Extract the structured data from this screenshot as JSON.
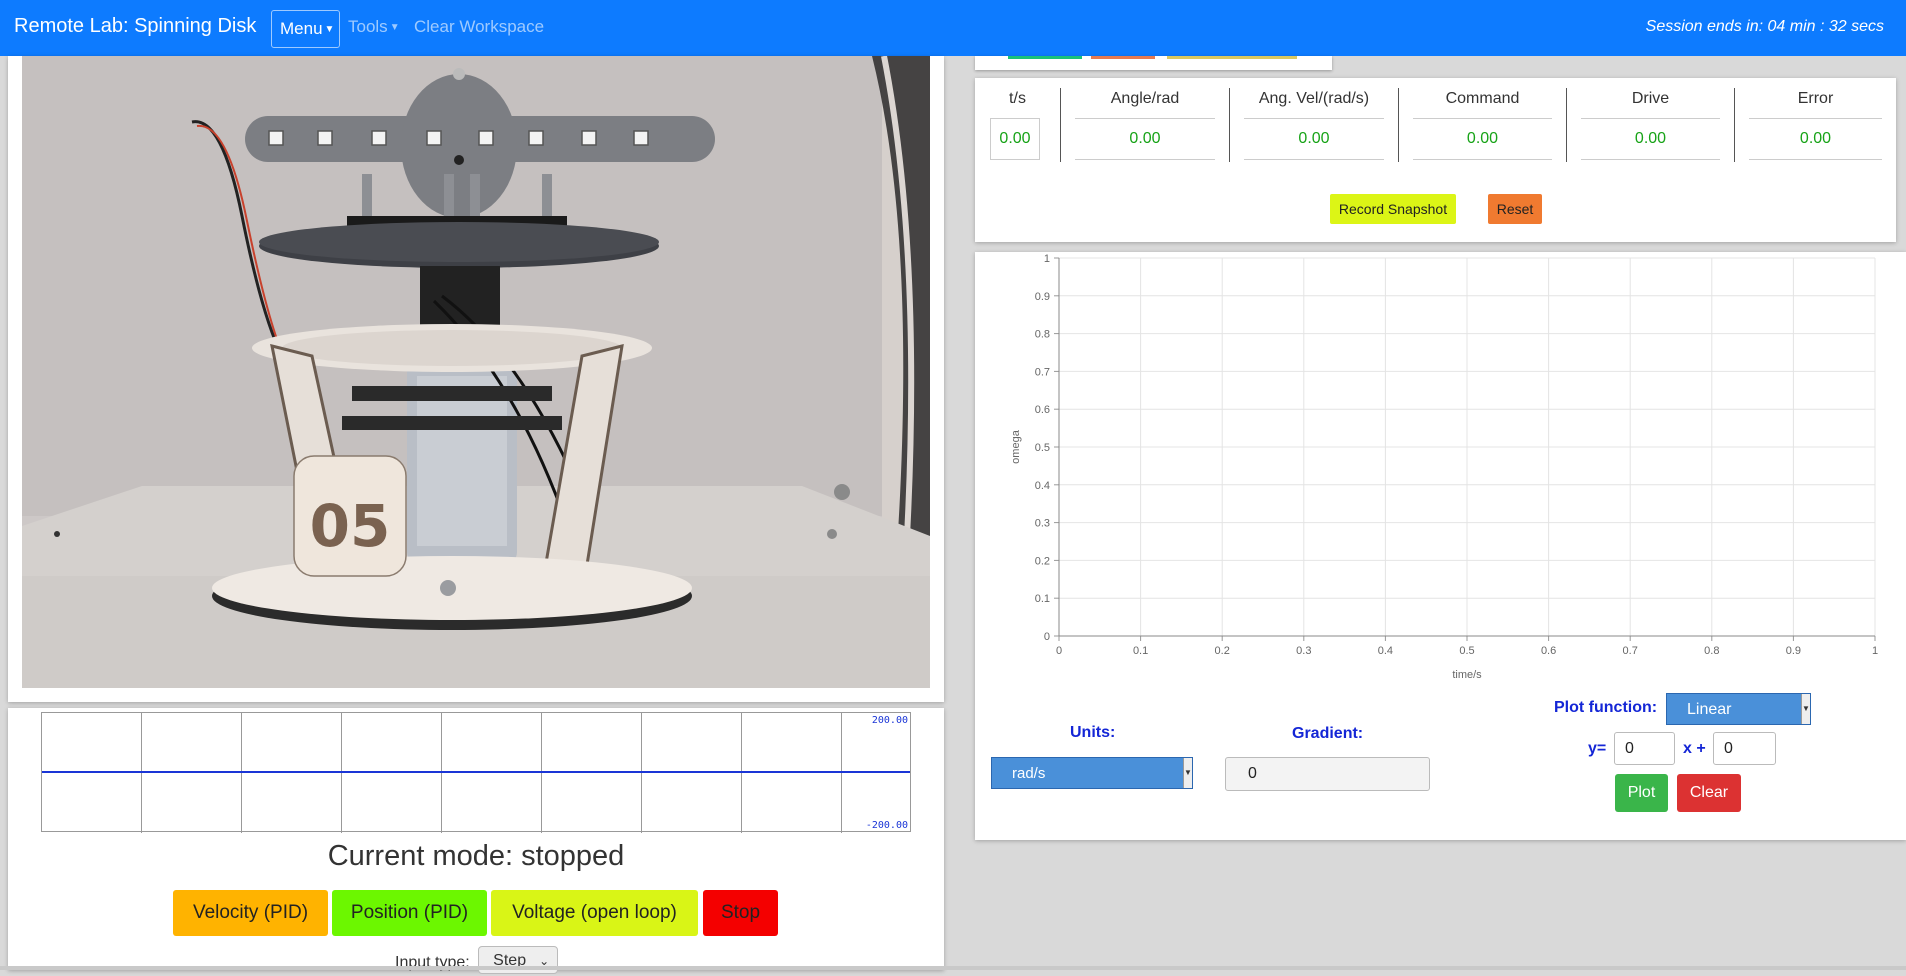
{
  "nav": {
    "brand": "Remote Lab: Spinning Disk",
    "menu": "Menu",
    "tools": "Tools",
    "clear_workspace": "Clear Workspace",
    "session": "Session ends in: 04 min : 32 secs"
  },
  "video": {
    "disk_number": "05"
  },
  "scope": {
    "top_label": "200.00",
    "bottom_label": "-200.00"
  },
  "mode": {
    "current": "Current mode: stopped",
    "buttons": [
      "Velocity (PID)",
      "Position (PID)",
      "Voltage (open loop)",
      "Stop"
    ],
    "colors": [
      "#ffb300",
      "#6cf700",
      "#d9f516",
      "#f40000"
    ],
    "input_type_label": "Input type:",
    "input_type_value": "Step"
  },
  "data_table": {
    "headers": [
      "t/s",
      "Angle/rad",
      "Ang. Vel/(rad/s)",
      "Command",
      "Drive",
      "Error"
    ],
    "values": [
      "0.00",
      "0.00",
      "0.00",
      "0.00",
      "0.00",
      "0.00"
    ],
    "record_snapshot": "Record Snapshot",
    "reset": "Reset"
  },
  "chart_data": {
    "type": "line",
    "xlabel": "time/s",
    "ylabel": "omega",
    "xlim": [
      0,
      1
    ],
    "ylim": [
      0,
      1
    ],
    "xticks": [
      "0",
      "0.1",
      "0.2",
      "0.3",
      "0.4",
      "0.5",
      "0.6",
      "0.7",
      "0.8",
      "0.9",
      "1"
    ],
    "yticks": [
      "0",
      "0.1",
      "0.2",
      "0.3",
      "0.4",
      "0.5",
      "0.6",
      "0.7",
      "0.8",
      "0.9",
      "1"
    ],
    "grid": true,
    "series": []
  },
  "plot_controls": {
    "units_label": "Units:",
    "units_value": "rad/s",
    "gradient_label": "Gradient:",
    "gradient_value": "0",
    "plot_function_label": "Plot function:",
    "plot_function_value": "Linear",
    "y_label": "y=",
    "y_value": "0",
    "x_label": "x +",
    "x_value": "0",
    "plot": "Plot",
    "clear": "Clear"
  }
}
